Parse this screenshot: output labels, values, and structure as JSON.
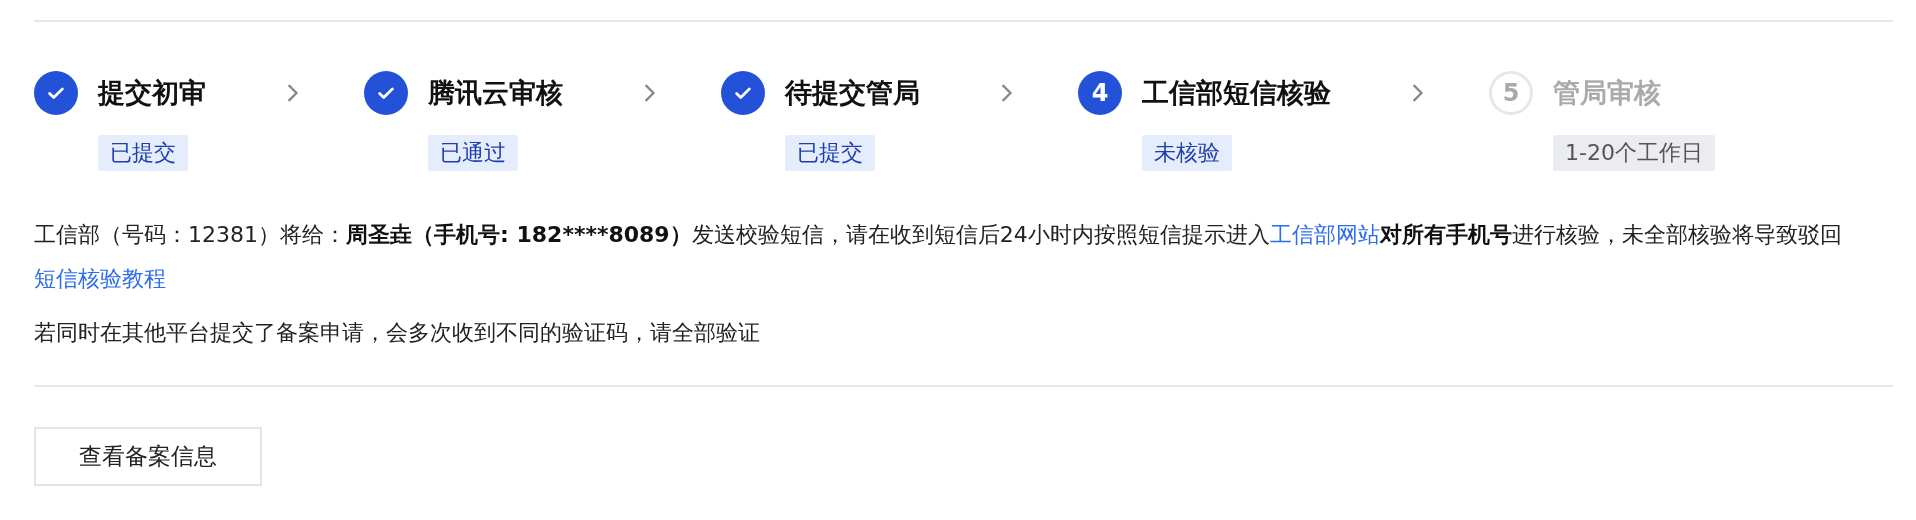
{
  "steps": [
    {
      "title": "提交初审",
      "kind": "done",
      "tag": "已提交"
    },
    {
      "title": "腾讯云审核",
      "kind": "done",
      "tag": "已通过"
    },
    {
      "title": "待提交管局",
      "kind": "done",
      "tag": "已提交"
    },
    {
      "title": "工信部短信核验",
      "kind": "current",
      "number": "4",
      "tag": "未核验"
    },
    {
      "title": "管局审核",
      "kind": "pending",
      "number": "5",
      "tag": "1-20个工作日"
    }
  ],
  "notice": [
    {
      "text": "工信部（号码：12381）将给：",
      "kind": "plain"
    },
    {
      "text": "周圣垚（手机号: 182****8089）",
      "kind": "bold"
    },
    {
      "text": "发送校验短信，请在收到短信后24小时内按照短信提示进入",
      "kind": "plain"
    },
    {
      "text": "工信部网站",
      "kind": "link"
    },
    {
      "text": "对所有手机号",
      "kind": "bold"
    },
    {
      "text": "进行核验，未全部核验将导致驳回",
      "kind": "plain"
    },
    {
      "text": "短信核验教程",
      "kind": "link"
    }
  ],
  "note": "若同时在其他平台提交了备案申请，会多次收到不同的验证码，请全部验证",
  "button": "查看备案信息"
}
